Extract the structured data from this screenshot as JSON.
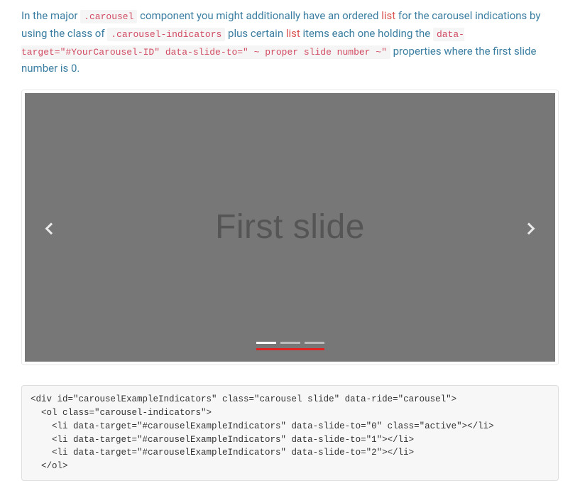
{
  "intro": {
    "seg1": "In the major ",
    "code1": ".carousel",
    "seg2": " component you might additionally have an ordered ",
    "kw1": "list",
    "seg3": " for the carousel indications by using the class of ",
    "code2": ".carousel-indicators",
    "seg4": " plus certain ",
    "kw2": "list",
    "seg5": " items each one holding the ",
    "code3": "data-target=\"#YourCarousel-ID\" data-slide-to=\" ~ proper slide number ~\"",
    "seg6": " properties where the first slide number is 0."
  },
  "carousel": {
    "slide_text": "First slide"
  },
  "code_block": "<div id=\"carouselExampleIndicators\" class=\"carousel slide\" data-ride=\"carousel\">\n  <ol class=\"carousel-indicators\">\n    <li data-target=\"#carouselExampleIndicators\" data-slide-to=\"0\" class=\"active\"></li>\n    <li data-target=\"#carouselExampleIndicators\" data-slide-to=\"1\"></li>\n    <li data-target=\"#carouselExampleIndicators\" data-slide-to=\"2\"></li>\n  </ol>"
}
